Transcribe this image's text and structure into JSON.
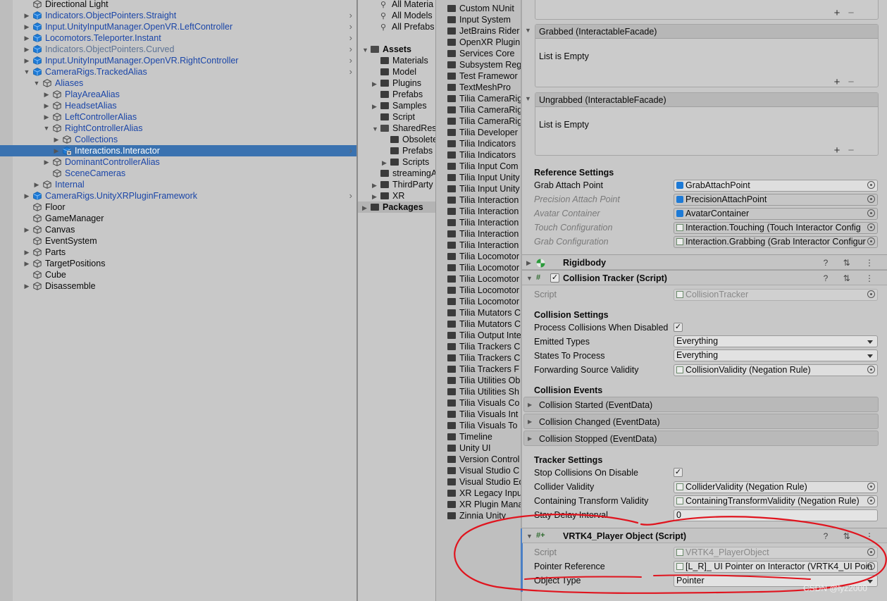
{
  "hierarchy": {
    "items": [
      {
        "label": "Directional Light",
        "kind": "go",
        "arrow": false,
        "depth": 0,
        "style": ""
      },
      {
        "label": "Indicators.ObjectPointers.Straight",
        "kind": "prefab",
        "arrow": true,
        "depth": 0,
        "style": "prefab",
        "chev": true
      },
      {
        "label": "Input.UnityInputManager.OpenVR.LeftController",
        "kind": "prefab",
        "arrow": true,
        "depth": 0,
        "style": "prefab",
        "chev": true
      },
      {
        "label": "Locomotors.Teleporter.Instant",
        "kind": "prefab",
        "arrow": true,
        "depth": 0,
        "style": "prefab",
        "chev": true
      },
      {
        "label": "Indicators.ObjectPointers.Curved",
        "kind": "prefab",
        "arrow": true,
        "depth": 0,
        "style": "grey",
        "chev": true
      },
      {
        "label": "Input.UnityInputManager.OpenVR.RightController",
        "kind": "prefab",
        "arrow": true,
        "depth": 0,
        "style": "prefab",
        "chev": true
      },
      {
        "label": "CameraRigs.TrackedAlias",
        "kind": "prefab",
        "arrow": "open",
        "depth": 0,
        "style": "prefab",
        "chev": true
      },
      {
        "label": "Aliases",
        "kind": "go",
        "arrow": "open",
        "depth": 1,
        "style": "prefab"
      },
      {
        "label": "PlayAreaAlias",
        "kind": "go",
        "arrow": true,
        "depth": 2,
        "style": "prefab"
      },
      {
        "label": "HeadsetAlias",
        "kind": "go",
        "arrow": true,
        "depth": 2,
        "style": "prefab"
      },
      {
        "label": "LeftControllerAlias",
        "kind": "go",
        "arrow": true,
        "depth": 2,
        "style": "prefab"
      },
      {
        "label": "RightControllerAlias",
        "kind": "go",
        "arrow": "open",
        "depth": 2,
        "style": "prefab"
      },
      {
        "label": "Collections",
        "kind": "go",
        "arrow": true,
        "depth": 3,
        "style": "prefab"
      },
      {
        "label": "Interactions.Interactor",
        "kind": "prefabadd",
        "arrow": true,
        "depth": 3,
        "style": "",
        "sel": true,
        "chev": true
      },
      {
        "label": "DominantControllerAlias",
        "kind": "go",
        "arrow": true,
        "depth": 2,
        "style": "prefab"
      },
      {
        "label": "SceneCameras",
        "kind": "go",
        "arrow": false,
        "depth": 2,
        "style": "prefab"
      },
      {
        "label": "Internal",
        "kind": "go",
        "arrow": true,
        "depth": 1,
        "style": "prefab"
      },
      {
        "label": "CameraRigs.UnityXRPluginFramework",
        "kind": "prefab",
        "arrow": true,
        "depth": 0,
        "style": "prefab",
        "chev": true
      },
      {
        "label": "Floor",
        "kind": "go",
        "arrow": false,
        "depth": 0,
        "style": ""
      },
      {
        "label": "GameManager",
        "kind": "go",
        "arrow": false,
        "depth": 0,
        "style": ""
      },
      {
        "label": "Canvas",
        "kind": "go",
        "arrow": true,
        "depth": 0,
        "style": ""
      },
      {
        "label": "EventSystem",
        "kind": "go",
        "arrow": false,
        "depth": 0,
        "style": ""
      },
      {
        "label": "Parts",
        "kind": "go",
        "arrow": true,
        "depth": 0,
        "style": ""
      },
      {
        "label": "TargetPositions",
        "kind": "go",
        "arrow": true,
        "depth": 0,
        "style": ""
      },
      {
        "label": "Cube",
        "kind": "go",
        "arrow": false,
        "depth": 0,
        "style": ""
      },
      {
        "label": "Disassemble",
        "kind": "go",
        "arrow": true,
        "depth": 0,
        "style": ""
      }
    ]
  },
  "project": {
    "tree": [
      {
        "label": "All Materia",
        "icon": "search",
        "depth": 1,
        "arrow": false,
        "bold": false
      },
      {
        "label": "All Models",
        "icon": "search",
        "depth": 1,
        "arrow": false,
        "bold": false
      },
      {
        "label": "All Prefabs",
        "icon": "search",
        "depth": 1,
        "arrow": false,
        "bold": false
      },
      {
        "label": "",
        "icon": "none",
        "depth": 0,
        "arrow": false,
        "bold": false
      },
      {
        "label": "Assets",
        "icon": "folder-open",
        "depth": 0,
        "arrow": "open",
        "bold": true
      },
      {
        "label": "Materials",
        "icon": "folder",
        "depth": 1,
        "arrow": false,
        "bold": false
      },
      {
        "label": "Model",
        "icon": "folder",
        "depth": 1,
        "arrow": false,
        "bold": false
      },
      {
        "label": "Plugins",
        "icon": "folder",
        "depth": 1,
        "arrow": true,
        "bold": false
      },
      {
        "label": "Prefabs",
        "icon": "folder",
        "depth": 1,
        "arrow": false,
        "bold": false
      },
      {
        "label": "Samples",
        "icon": "folder",
        "depth": 1,
        "arrow": true,
        "bold": false
      },
      {
        "label": "Script",
        "icon": "folder",
        "depth": 1,
        "arrow": false,
        "bold": false
      },
      {
        "label": "SharedRes",
        "icon": "folder-open",
        "depth": 1,
        "arrow": "open",
        "bold": false
      },
      {
        "label": "Obsolete",
        "icon": "folder",
        "depth": 2,
        "arrow": false,
        "bold": false
      },
      {
        "label": "Prefabs",
        "icon": "folder",
        "depth": 2,
        "arrow": false,
        "bold": false
      },
      {
        "label": "Scripts",
        "icon": "folder",
        "depth": 2,
        "arrow": true,
        "bold": false
      },
      {
        "label": "streamingA",
        "icon": "folder",
        "depth": 1,
        "arrow": false,
        "bold": false
      },
      {
        "label": "ThirdParty",
        "icon": "folder",
        "depth": 1,
        "arrow": true,
        "bold": false
      },
      {
        "label": "XR",
        "icon": "folder",
        "depth": 1,
        "arrow": true,
        "bold": false
      },
      {
        "label": "Packages",
        "icon": "folder",
        "depth": 0,
        "arrow": true,
        "bold": true
      }
    ],
    "files": [
      "Custom NUnit",
      "Input System",
      "JetBrains Rider",
      "OpenXR Plugin",
      "Services Core",
      "Subsystem Reg",
      "Test Framewor",
      "TextMeshPro",
      "Tilia CameraRig",
      "Tilia CameraRig",
      "Tilia CameraRig",
      "Tilia Developer",
      "Tilia Indicators",
      "Tilia Indicators",
      "Tilia Input Com",
      "Tilia Input Unity",
      "Tilia Input Unity",
      "Tilia Interaction",
      "Tilia Interaction",
      "Tilia Interaction",
      "Tilia Interaction",
      "Tilia Interaction",
      "Tilia Locomotor",
      "Tilia Locomotor",
      "Tilia Locomotor",
      "Tilia Locomotor",
      "Tilia Locomotor",
      "Tilia Mutators C",
      "Tilia Mutators C",
      "Tilia Output Inte",
      "Tilia Trackers C",
      "Tilia Trackers C",
      "Tilia Trackers F",
      "Tilia Utilities Ob",
      "Tilia Utilities Sh",
      "Tilia Visuals Co",
      "Tilia Visuals Int",
      "Tilia Visuals To",
      "Timeline",
      "Unity UI",
      "Version Control",
      "Visual Studio C",
      "Visual Studio Ed",
      "XR Legacy Inpu",
      "XR Plugin Mana",
      "Zinnia Unity"
    ]
  },
  "inspector": {
    "grabbed": {
      "header": "Grabbed (InteractableFacade)",
      "body": "List is Empty"
    },
    "ungrabbed": {
      "header": "Ungrabbed (InteractableFacade)",
      "body": "List is Empty"
    },
    "plus": "+",
    "minus": "−",
    "reference_settings": "Reference Settings",
    "refs": [
      {
        "label": "Grab Attach Point",
        "value": "GrabAttachPoint",
        "dim": false,
        "icon": "cube"
      },
      {
        "label": "Precision Attach Point",
        "value": "PrecisionAttachPoint",
        "dim": true,
        "icon": "cube"
      },
      {
        "label": "Avatar Container",
        "value": "AvatarContainer",
        "dim": true,
        "icon": "cube"
      },
      {
        "label": "Touch Configuration",
        "value": "Interaction.Touching (Touch Interactor Config",
        "dim": true,
        "icon": "script"
      },
      {
        "label": "Grab Configuration",
        "value": "Interaction.Grabbing (Grab Interactor Configur",
        "dim": true,
        "icon": "script"
      }
    ],
    "rigidbody": "Rigidbody",
    "collision_tracker": "Collision Tracker (Script)",
    "script_label": "Script",
    "ct_script": "CollisionTracker",
    "collision_settings": "Collision Settings",
    "process_disabled": "Process Collisions When Disabled",
    "emitted_types": "Emitted Types",
    "emitted_value": "Everything",
    "states_to_process": "States To Process",
    "states_value": "Everything",
    "forwarding_validity": "Forwarding Source Validity",
    "forwarding_value": "CollisionValidity (Negation Rule)",
    "collision_events": "Collision Events",
    "events": [
      "Collision Started (EventData)",
      "Collision Changed (EventData)",
      "Collision Stopped (EventData)"
    ],
    "tracker_settings": "Tracker Settings",
    "stop_on_disable": "Stop Collisions On Disable",
    "collider_validity": "Collider Validity",
    "collider_value": "ColliderValidity (Negation Rule)",
    "containing_validity": "Containing Transform Validity",
    "containing_value": "ContainingTransformValidity (Negation Rule)",
    "stay_delay": "Stay Delay Interval",
    "stay_value": "0",
    "vrtk_component": "VRTK4_Player Object (Script)",
    "vrtk_script": "VRTK4_PlayerObject",
    "pointer_reference": "Pointer Reference",
    "pointer_value": "[L_R]_ UI Pointer on Interactor (VRTK4_UI Poin",
    "object_type": "Object Type",
    "object_type_value": "Pointer",
    "check": "✓",
    "comp_icons": "? ⇅ ⋮"
  },
  "watermark": "CSDN @lyz2000",
  "colors": {
    "annotation": "#e0141e",
    "selection": "#3a72b0",
    "prefab_text": "#1b46a8"
  }
}
